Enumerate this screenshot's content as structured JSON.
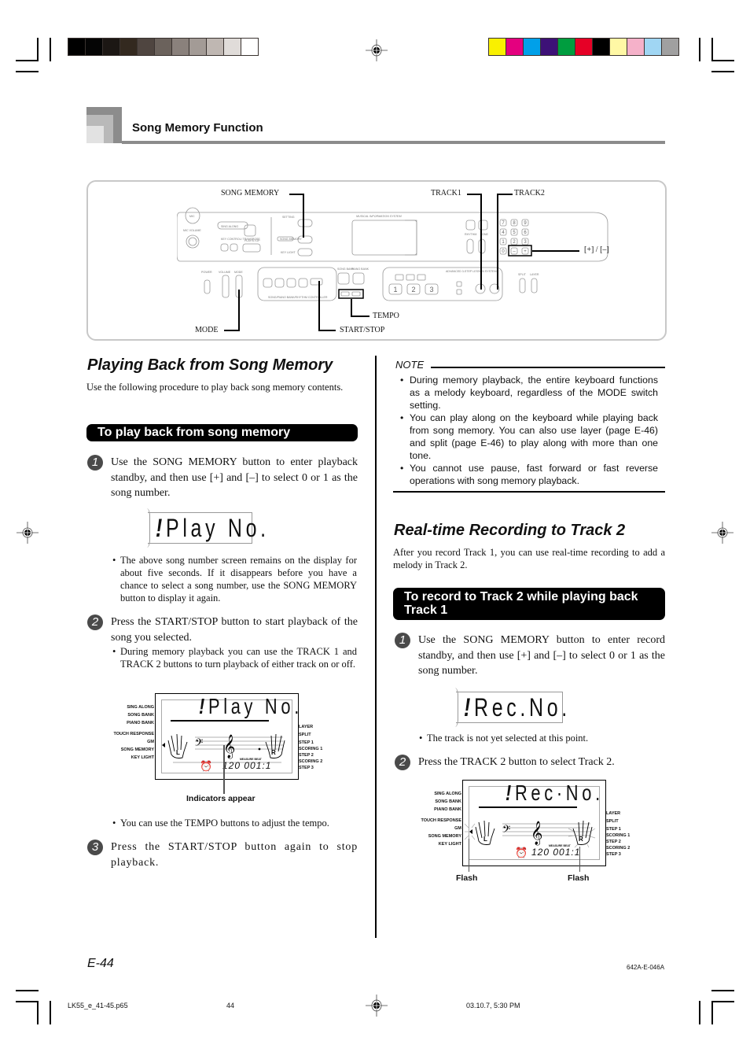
{
  "print_marks": {
    "grayscale_swatches": [
      "#000000",
      "#050505",
      "#1c1714",
      "#33291f",
      "#4f4540",
      "#6b625c",
      "#8a817c",
      "#a39b96",
      "#bfb7b2",
      "#e0dcd9",
      "#ffffff"
    ],
    "color_swatches": [
      "#f9f000",
      "#e4007f",
      "#00a0e9",
      "#3d1177",
      "#009d3f",
      "#e60026",
      "#000000",
      "#fff8a5",
      "#f5b1c9",
      "#a0d6f3",
      "#a0a0a0"
    ]
  },
  "header": {
    "section_title": "Song Memory Function"
  },
  "figure": {
    "callouts": {
      "song_memory": "SONG MEMORY",
      "track1": "TRACK1",
      "track2": "TRACK2",
      "plus_minus": "[+] / [–]",
      "tempo": "TEMPO",
      "mode": "MODE",
      "start_stop": "START/STOP"
    },
    "panel_labels": {
      "mic": "MIC",
      "mic_volume": "MIC VOLUME",
      "sing_along": "SING ALONG",
      "key_control": "KEY CONTROL/ TRANSPOSE",
      "play_stop": "PLAY/STOP",
      "setting": "SETTING",
      "song_memory": "SONG MEMORY",
      "key_light": "KEY LIGHT",
      "display_title": "MUSICAL INFORMATION SYSTEM",
      "rhythm": "RHYTHM",
      "tone": "TONE",
      "power": "POWER",
      "volume": "VOLUME",
      "mode": "MODE",
      "song_bank": "SONG BANK",
      "piano_bank": "PIANO BANK",
      "controller": "SONG/PIANO BANK/RHYTHM CONTROLLER",
      "lesson": "ADVANCED 3-STEP LESSON SYSTEM",
      "split": "SPLIT",
      "layer": "LAYER",
      "keypad": [
        "7",
        "8",
        "9",
        "4",
        "5",
        "6",
        "1",
        "2",
        "3",
        "0",
        "–",
        "+"
      ],
      "steps": [
        "1",
        "2",
        "3"
      ]
    }
  },
  "left": {
    "title": "Playing Back from Song Memory",
    "intro": "Use the following procedure to play back song memory contents.",
    "procedure_title": "To play back from song memory",
    "steps": [
      {
        "num": "1",
        "text": "Use the SONG MEMORY button to enter playback standby, and then use [+] and [–] to select 0 or 1 as the song number."
      },
      {
        "num": "2",
        "text": "Press the START/STOP button to start playback of the song you selected."
      },
      {
        "num": "3",
        "text": "Press the START/STOP button again to stop playback."
      }
    ],
    "lcd1": "Play No.",
    "bullet1": "The above song number screen remains on the display for about five seconds. If it disappears before you have a chance to select a song number, use the SONG MEMORY button to display it again.",
    "bullet2": "During memory playback you can use the TRACK 1 and TRACK 2 buttons to turn playback of either track on or off.",
    "lcd2": {
      "text": "Play No.",
      "tempo": "120",
      "measure_beat": "001:1",
      "measure_beat_label": "MEASURE BEAT",
      "left_labels": [
        "SING ALONG",
        "SONG BANK",
        "PIANO BANK",
        "TOUCH RESPONSE",
        "GM",
        "SONG MEMORY",
        "KEY LIGHT"
      ],
      "right_labels": [
        "LAYER",
        "SPLIT",
        "STEP 1",
        "SCORING 1",
        "STEP 2",
        "SCORING 2",
        "STEP 3"
      ],
      "hand_left": "L",
      "hand_right": "R"
    },
    "caption": "Indicators appear",
    "bullet3": "You can use the TEMPO buttons to adjust the tempo."
  },
  "note": {
    "title": "NOTE",
    "items": [
      "During memory playback, the entire keyboard functions as a melody keyboard, regardless of the MODE switch setting.",
      "You can play along on the keyboard while playing back from song memory. You can also use layer (page E-46) and split (page E-46) to play along with more than one tone.",
      "You cannot use pause, fast forward or fast reverse operations with song memory playback."
    ]
  },
  "right": {
    "title": "Real-time Recording to Track 2",
    "intro": "After you record Track 1, you can use real-time recording to add a melody in Track 2.",
    "procedure_title": "To record to Track 2 while playing back Track 1",
    "steps": [
      {
        "num": "1",
        "text": "Use the SONG MEMORY button to enter record standby, and then use [+] and [–] to select 0 or 1 as the song number."
      },
      {
        "num": "2",
        "text": "Press the TRACK 2 button to select Track 2."
      }
    ],
    "lcd1": "Rec.No.",
    "bullet1": "The track is not yet selected at this point.",
    "lcd2": {
      "text": "Rec·No.",
      "tempo": "120",
      "measure_beat": "001:1",
      "measure_beat_label": "MEASURE BEAT",
      "left_labels": [
        "SING ALONG",
        "SONG BANK",
        "PIANO BANK",
        "TOUCH RESPONSE",
        "GM",
        "SONG MEMORY",
        "KEY LIGHT"
      ],
      "right_labels": [
        "LAYER",
        "SPLIT",
        "STEP 1",
        "SCORING 1",
        "STEP 2",
        "SCORING 2",
        "STEP 3"
      ],
      "hand_left": "L",
      "hand_right": "R"
    },
    "caption_left": "Flash",
    "caption_right": "Flash"
  },
  "footer": {
    "page_number": "E-44",
    "doc_code": "642A-E-046A",
    "file_name": "LK55_e_41-45.p65",
    "sheet": "44",
    "timestamp": "03.10.7, 5:30 PM"
  }
}
